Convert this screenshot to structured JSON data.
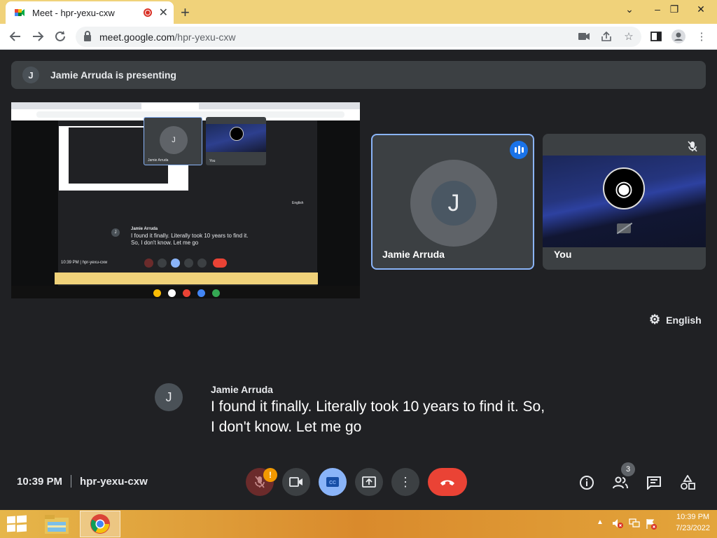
{
  "browser": {
    "tab_title": "Meet - hpr-yexu-cxw",
    "tab_close": "✕",
    "new_tab": "+",
    "url_host": "meet.google.com",
    "url_path": "/hpr-yexu-cxw",
    "window_buttons": [
      "⌄",
      "–",
      "❐",
      "✕"
    ]
  },
  "meet": {
    "presenting_initial": "J",
    "presenting_text": "Jamie Arruda is presenting",
    "tiles": [
      {
        "initial": "J",
        "name": "Jamie Arruda",
        "speaking": true
      },
      {
        "name": "You",
        "muted": true,
        "camera_off": true
      }
    ],
    "language_label": "English",
    "caption": {
      "initial": "J",
      "speaker": "Jamie Arruda",
      "text": "I found it finally. Literally took 10 years to find it. So, I don't know. Let me go"
    },
    "time": "10:39 PM",
    "meeting_code": "hpr-yexu-cxw",
    "participants_count": "3",
    "mic_warning": "!",
    "colors": {
      "accent": "#8ab4f8",
      "cc_active": "#8ab4f8",
      "end_call": "#ea4335",
      "mic_off": "#6b2b2b"
    }
  },
  "shared_screen": {
    "initial": "J",
    "tile_name": "Jamie Arruda",
    "tile_you": "You",
    "language_label": "English",
    "caption_speaker": "Jamie Arruda",
    "caption_text": "I found it finally. Literally took 10 years to find it. So, I don't know. Let me go",
    "time": "10:39 PM",
    "code": "hpr-yexu-cxw"
  },
  "taskbar": {
    "clock_time": "10:39 PM",
    "clock_date": "7/23/2022"
  }
}
